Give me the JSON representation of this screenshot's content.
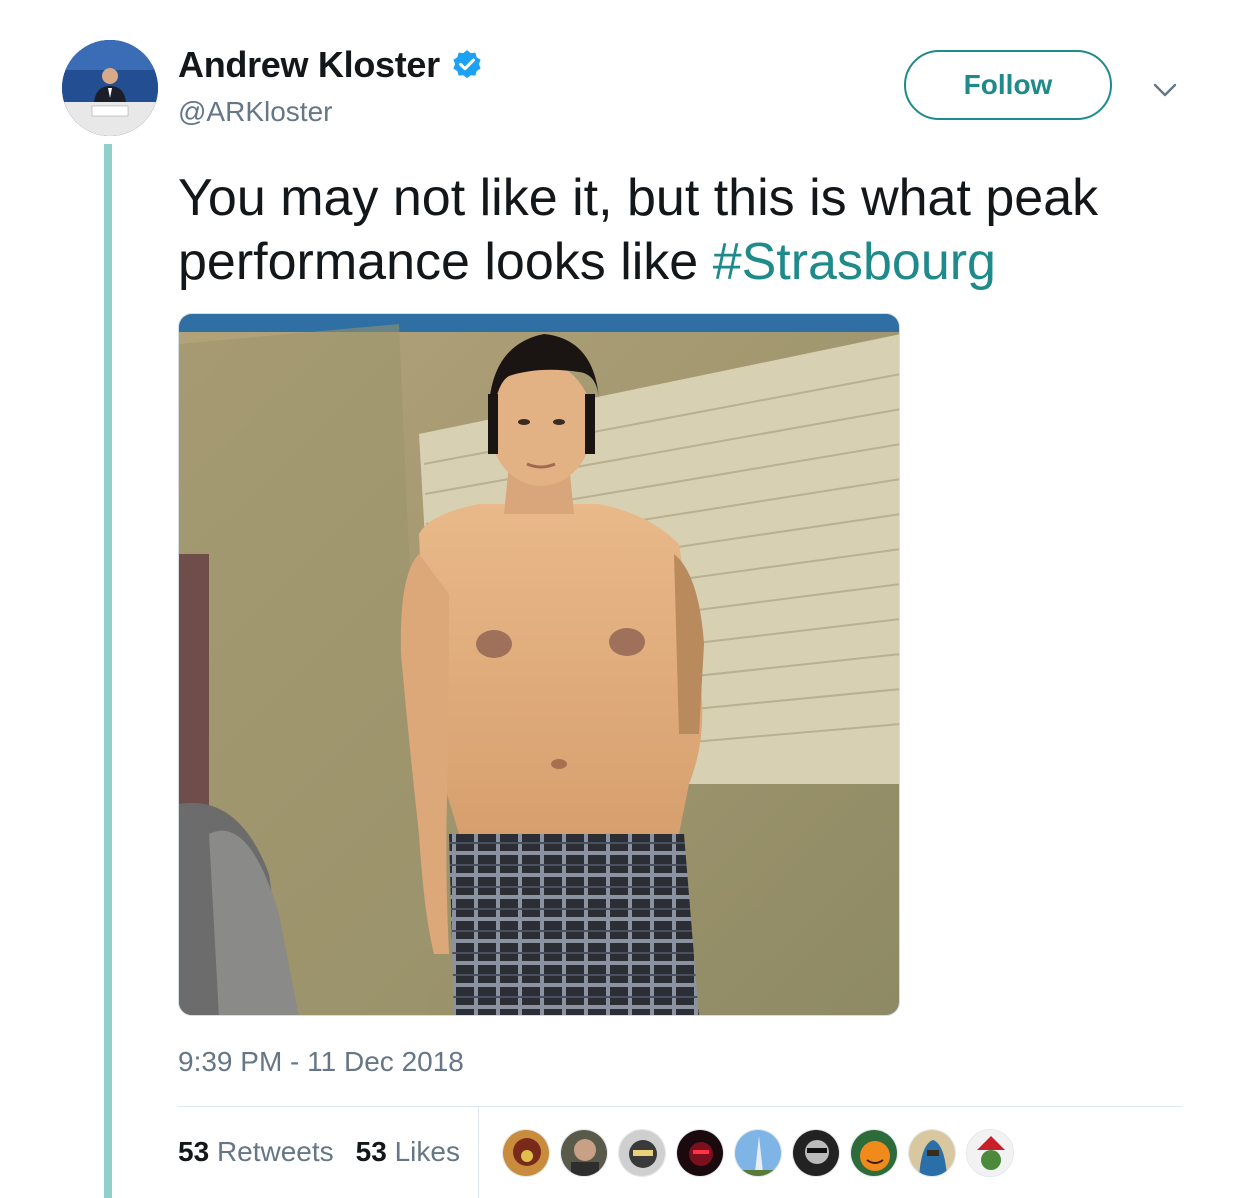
{
  "author": {
    "display_name": "Andrew Kloster",
    "handle": "@ARKloster",
    "verified": true,
    "avatar_icon": "avatar-photo-speaker-at-podium"
  },
  "follow": {
    "label": "Follow"
  },
  "menu_icon": "chevron-down-icon",
  "tweet": {
    "text": "You may not like it, but this is what peak performance looks like ",
    "hashtag": "#Strasbourg"
  },
  "media": {
    "image_icon": "photo-shirtless-man-plaid-boxers"
  },
  "timestamp": "9:39 PM - 11 Dec 2018",
  "stats": {
    "retweets_count": "53",
    "retweets_label": "Retweets",
    "likes_count": "53",
    "likes_label": "Likes"
  },
  "liker_avatars": [
    "liker-avatar-1",
    "liker-avatar-2",
    "liker-avatar-3",
    "liker-avatar-4",
    "liker-avatar-5",
    "liker-avatar-6",
    "liker-avatar-7",
    "liker-avatar-8",
    "liker-avatar-9"
  ],
  "colors": {
    "accent": "#1f8a8a",
    "thread_line": "#8fd0cd",
    "secondary_text": "#657786",
    "verified": "#1da1f2"
  }
}
